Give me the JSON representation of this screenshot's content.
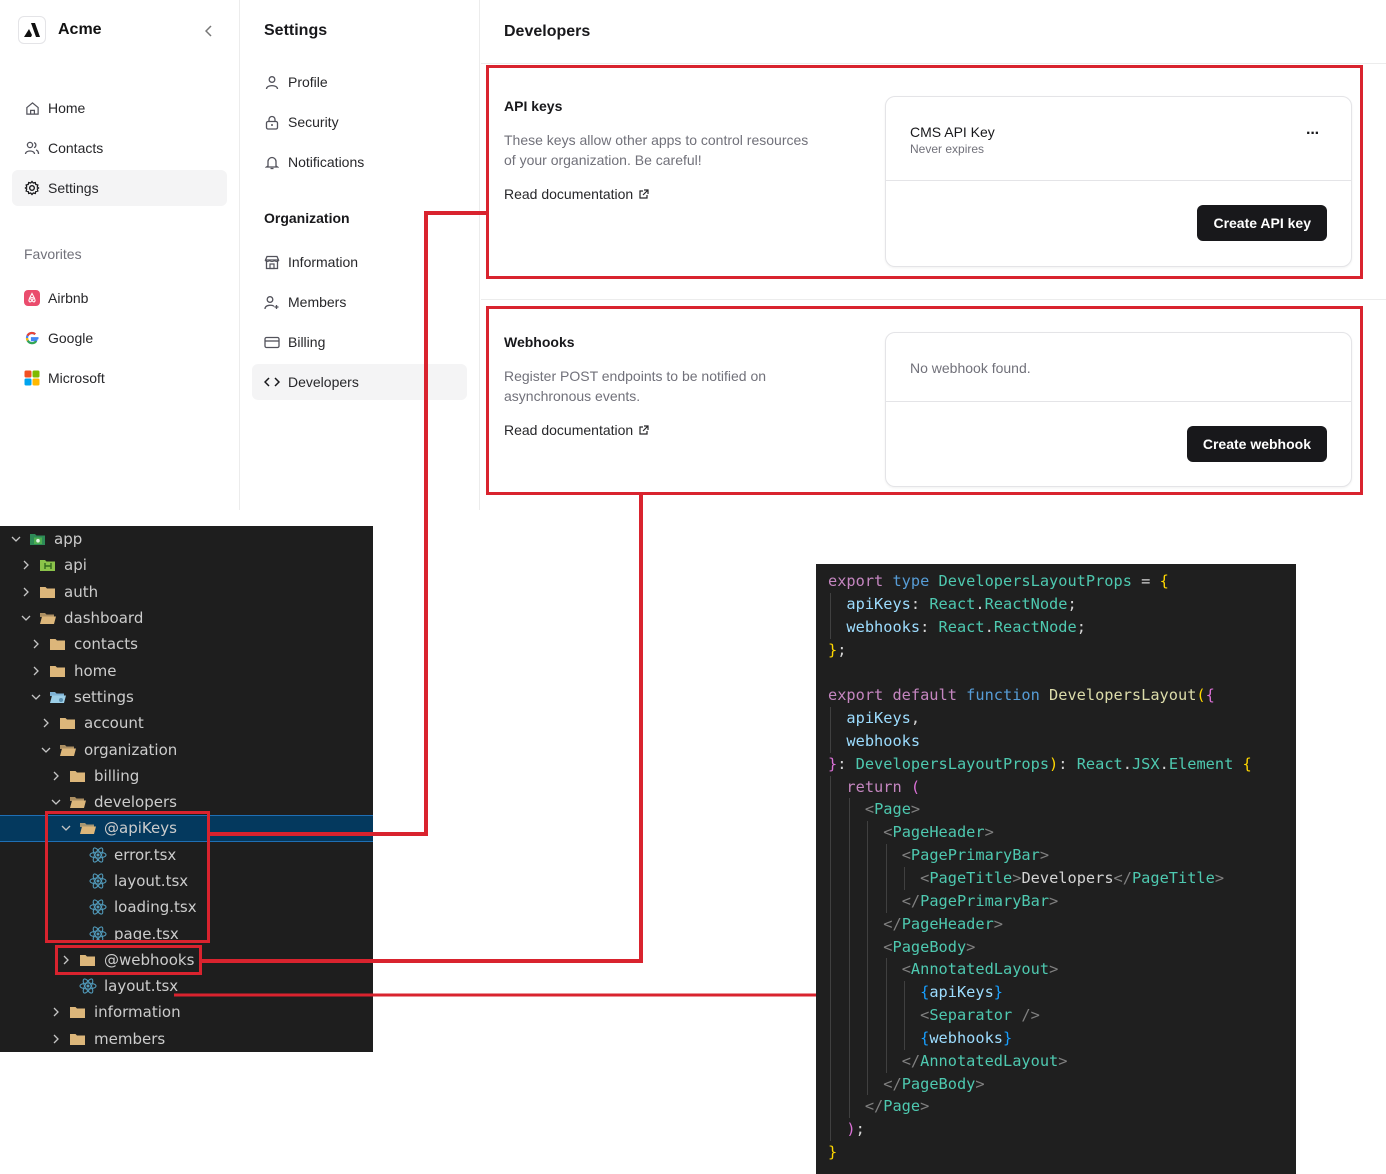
{
  "sidebar": {
    "brand": "Acme",
    "nav": [
      {
        "label": "Home",
        "icon": "home-icon",
        "active": false
      },
      {
        "label": "Contacts",
        "icon": "contacts-icon",
        "active": false
      },
      {
        "label": "Settings",
        "icon": "gear-icon",
        "active": true
      }
    ],
    "favorites_title": "Favorites",
    "favorites": [
      {
        "label": "Airbnb",
        "icon": "airbnb-icon"
      },
      {
        "label": "Google",
        "icon": "google-icon"
      },
      {
        "label": "Microsoft",
        "icon": "microsoft-icon"
      }
    ]
  },
  "settings_nav": {
    "title": "Settings",
    "account_items": [
      {
        "label": "Profile",
        "icon": "user-icon"
      },
      {
        "label": "Security",
        "icon": "lock-icon"
      },
      {
        "label": "Notifications",
        "icon": "bell-icon"
      }
    ],
    "organization_title": "Organization",
    "organization_items": [
      {
        "label": "Information",
        "icon": "store-icon"
      },
      {
        "label": "Members",
        "icon": "user-plus-icon"
      },
      {
        "label": "Billing",
        "icon": "credit-card-icon"
      },
      {
        "label": "Developers",
        "icon": "code-icon",
        "active": true
      }
    ]
  },
  "main": {
    "title": "Developers",
    "api_keys": {
      "title": "API keys",
      "description": "These keys allow other apps to control resources of your organization. Be careful!",
      "doc_link": "Read documentation",
      "key_name": "CMS API Key",
      "key_expiry": "Never expires",
      "more_label": "···",
      "create_button": "Create API key"
    },
    "webhooks": {
      "title": "Webhooks",
      "description": "Register POST endpoints to be notified on asynchronous events.",
      "doc_link": "Read documentation",
      "empty_text": "No webhook found.",
      "create_button": "Create webhook"
    }
  },
  "file_tree": [
    {
      "name": "app",
      "depth": 0,
      "type": "folder-app",
      "open": true
    },
    {
      "name": "api",
      "depth": 1,
      "type": "folder-api",
      "open": false
    },
    {
      "name": "auth",
      "depth": 1,
      "type": "folder",
      "open": false
    },
    {
      "name": "dashboard",
      "depth": 1,
      "type": "folder",
      "open": true
    },
    {
      "name": "contacts",
      "depth": 2,
      "type": "folder",
      "open": false
    },
    {
      "name": "home",
      "depth": 2,
      "type": "folder",
      "open": false
    },
    {
      "name": "settings",
      "depth": 2,
      "type": "folder-settings",
      "open": true
    },
    {
      "name": "account",
      "depth": 3,
      "type": "folder",
      "open": false
    },
    {
      "name": "organization",
      "depth": 3,
      "type": "folder",
      "open": true
    },
    {
      "name": "billing",
      "depth": 4,
      "type": "folder",
      "open": false
    },
    {
      "name": "developers",
      "depth": 4,
      "type": "folder",
      "open": true
    },
    {
      "name": "@apiKeys",
      "depth": 5,
      "type": "folder",
      "open": true,
      "selected": true
    },
    {
      "name": "error.tsx",
      "depth": 6,
      "type": "react"
    },
    {
      "name": "layout.tsx",
      "depth": 6,
      "type": "react"
    },
    {
      "name": "loading.tsx",
      "depth": 6,
      "type": "react"
    },
    {
      "name": "page.tsx",
      "depth": 6,
      "type": "react"
    },
    {
      "name": "@webhooks",
      "depth": 5,
      "type": "folder",
      "open": false
    },
    {
      "name": "layout.tsx",
      "depth": 5,
      "type": "react"
    },
    {
      "name": "information",
      "depth": 4,
      "type": "folder",
      "open": false
    },
    {
      "name": "members",
      "depth": 4,
      "type": "folder",
      "open": false
    }
  ],
  "code_lines": [
    [
      [
        "kw",
        "export "
      ],
      [
        "kw2",
        "type "
      ],
      [
        "ty",
        "DevelopersLayoutProps"
      ],
      [
        "tx",
        " = "
      ],
      [
        "br1",
        "{"
      ]
    ],
    [
      [
        "tx",
        "  "
      ],
      [
        "pr",
        "apiKeys"
      ],
      [
        "tx",
        ": "
      ],
      [
        "ty",
        "React"
      ],
      [
        "tx",
        "."
      ],
      [
        "ty",
        "ReactNode"
      ],
      [
        "tx",
        ";"
      ]
    ],
    [
      [
        "tx",
        "  "
      ],
      [
        "pr",
        "webhooks"
      ],
      [
        "tx",
        ": "
      ],
      [
        "ty",
        "React"
      ],
      [
        "tx",
        "."
      ],
      [
        "ty",
        "ReactNode"
      ],
      [
        "tx",
        ";"
      ]
    ],
    [
      [
        "br1",
        "}"
      ],
      [
        "tx",
        ";"
      ]
    ],
    [],
    [
      [
        "kw",
        "export default "
      ],
      [
        "kw2",
        "function "
      ],
      [
        "fn",
        "DevelopersLayout"
      ],
      [
        "br1",
        "("
      ],
      [
        "br2",
        "{"
      ]
    ],
    [
      [
        "tx",
        "  "
      ],
      [
        "pr",
        "apiKeys"
      ],
      [
        "tx",
        ","
      ]
    ],
    [
      [
        "tx",
        "  "
      ],
      [
        "pr",
        "webhooks"
      ]
    ],
    [
      [
        "br2",
        "}"
      ],
      [
        "tx",
        ": "
      ],
      [
        "ty",
        "DevelopersLayoutProps"
      ],
      [
        "br1",
        ")"
      ],
      [
        "tx",
        ": "
      ],
      [
        "ty",
        "React"
      ],
      [
        "tx",
        "."
      ],
      [
        "ty",
        "JSX"
      ],
      [
        "tx",
        "."
      ],
      [
        "ty",
        "Element"
      ],
      [
        "tx",
        " "
      ],
      [
        "br1",
        "{"
      ]
    ],
    [
      [
        "tx",
        "  "
      ],
      [
        "kw",
        "return "
      ],
      [
        "br2",
        "("
      ]
    ],
    [
      [
        "tx",
        "    "
      ],
      [
        "ang",
        "<"
      ],
      [
        "tg",
        "Page"
      ],
      [
        "ang",
        ">"
      ]
    ],
    [
      [
        "tx",
        "      "
      ],
      [
        "ang",
        "<"
      ],
      [
        "tg",
        "PageHeader"
      ],
      [
        "ang",
        ">"
      ]
    ],
    [
      [
        "tx",
        "        "
      ],
      [
        "ang",
        "<"
      ],
      [
        "tg",
        "PagePrimaryBar"
      ],
      [
        "ang",
        ">"
      ]
    ],
    [
      [
        "tx",
        "          "
      ],
      [
        "ang",
        "<"
      ],
      [
        "tg",
        "PageTitle"
      ],
      [
        "ang",
        ">"
      ],
      [
        "tx",
        "Developers"
      ],
      [
        "ang",
        "</"
      ],
      [
        "tg",
        "PageTitle"
      ],
      [
        "ang",
        ">"
      ]
    ],
    [
      [
        "tx",
        "        "
      ],
      [
        "ang",
        "</"
      ],
      [
        "tg",
        "PagePrimaryBar"
      ],
      [
        "ang",
        ">"
      ]
    ],
    [
      [
        "tx",
        "      "
      ],
      [
        "ang",
        "</"
      ],
      [
        "tg",
        "PageHeader"
      ],
      [
        "ang",
        ">"
      ]
    ],
    [
      [
        "tx",
        "      "
      ],
      [
        "ang",
        "<"
      ],
      [
        "tg",
        "PageBody"
      ],
      [
        "ang",
        ">"
      ]
    ],
    [
      [
        "tx",
        "        "
      ],
      [
        "ang",
        "<"
      ],
      [
        "tg",
        "AnnotatedLayout"
      ],
      [
        "ang",
        ">"
      ]
    ],
    [
      [
        "tx",
        "          "
      ],
      [
        "br3",
        "{"
      ],
      [
        "pr",
        "apiKeys"
      ],
      [
        "br3",
        "}"
      ]
    ],
    [
      [
        "tx",
        "          "
      ],
      [
        "ang",
        "<"
      ],
      [
        "tg",
        "Separator"
      ],
      [
        "ang",
        " />"
      ]
    ],
    [
      [
        "tx",
        "          "
      ],
      [
        "br3",
        "{"
      ],
      [
        "pr",
        "webhooks"
      ],
      [
        "br3",
        "}"
      ]
    ],
    [
      [
        "tx",
        "        "
      ],
      [
        "ang",
        "</"
      ],
      [
        "tg",
        "AnnotatedLayout"
      ],
      [
        "ang",
        ">"
      ]
    ],
    [
      [
        "tx",
        "      "
      ],
      [
        "ang",
        "</"
      ],
      [
        "tg",
        "PageBody"
      ],
      [
        "ang",
        ">"
      ]
    ],
    [
      [
        "tx",
        "    "
      ],
      [
        "ang",
        "</"
      ],
      [
        "tg",
        "Page"
      ],
      [
        "ang",
        ">"
      ]
    ],
    [
      [
        "tx",
        "  "
      ],
      [
        "br2",
        ")"
      ],
      [
        "tx",
        ";"
      ]
    ],
    [
      [
        "br1",
        "}"
      ]
    ]
  ],
  "colors": {
    "annotation": "#d9232e",
    "selection": "#04395e",
    "folder": "#dcb67a",
    "react": "#519aba"
  }
}
